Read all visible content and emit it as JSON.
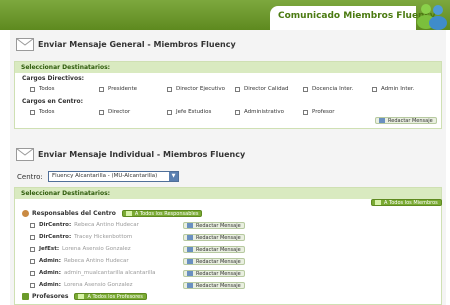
{
  "header": {
    "title": "Comunicado Miembros Fluency"
  },
  "general": {
    "title": "Enviar Mensaje General - Miembros Fluency",
    "recipients_bar": "Seleccionar Destinatarios:",
    "cargos_directivos_label": "Cargos Directivos:",
    "cargos_directivos": [
      "Todos",
      "Presidente",
      "Director Ejecutivo",
      "Director Calidad",
      "Docencia Inter.",
      "Admin Inter."
    ],
    "cargos_centro_label": "Cargos en Centro:",
    "cargos_centro": [
      "Todos",
      "Director",
      "Jefe Estudios",
      "Administrativo",
      "Profesor"
    ],
    "compose_button": "Redactar Mensaje"
  },
  "individual": {
    "title": "Enviar Mensaje Individual - Miembros Fluency",
    "centro_label": "Centro:",
    "centro_value": "Fluency Alcantarilla - (MU-Alcantarilla)",
    "recipients_bar": "Seleccionar Destinatarios:",
    "all_members_button": "A Todos los Miembros",
    "responsables": {
      "title": "Responsables del Centro",
      "all_button": "A Todos los Responsables",
      "rows": [
        {
          "role": "DirCentro:",
          "person": "Rebeca Antino Hudecar",
          "action": "Redactar Mensaje"
        },
        {
          "role": "DirCentro:",
          "person": "Tracey Hickenbottom",
          "action": "Redactar Mensaje"
        },
        {
          "role": "JefEst:",
          "person": "Lorena Asensio Gonzalez",
          "action": "Redactar Mensaje"
        },
        {
          "role": "Admin:",
          "person": "Rebeca Antino Hudecar",
          "action": "Redactar Mensaje"
        },
        {
          "role": "Admin:",
          "person": "admin_mualcantarilla alcantarilla",
          "action": "Redactar Mensaje"
        },
        {
          "role": "Admin:",
          "person": "Lorena Asensio Gonzalez",
          "action": "Redactar Mensaje"
        }
      ]
    },
    "profesores": {
      "title": "Profesores",
      "all_button": "A Todos los Profesores"
    }
  }
}
